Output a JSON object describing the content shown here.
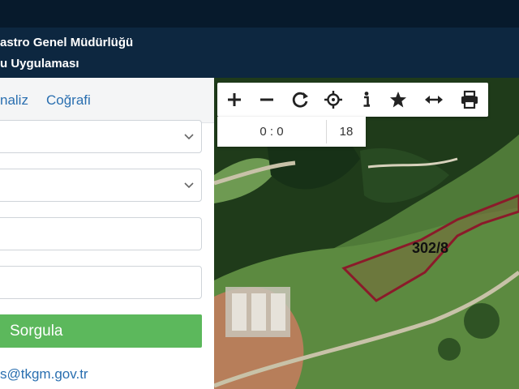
{
  "header": {
    "title_line1": "astro Genel Müdürlüğü",
    "title_line2": "u Uygulaması"
  },
  "panel": {
    "tabs": [
      {
        "label": "naliz"
      },
      {
        "label": "Coğrafi"
      }
    ],
    "fields": [
      {
        "type": "select",
        "value": ""
      },
      {
        "type": "select",
        "value": ""
      },
      {
        "type": "text",
        "value": ""
      },
      {
        "type": "text",
        "value": ""
      }
    ],
    "query_button": "Sorgula",
    "contact_email": "s@tkgm.gov.tr"
  },
  "map": {
    "toolbar": {
      "tools": [
        "zoom-in-icon",
        "zoom-out-icon",
        "refresh-icon",
        "locate-icon",
        "info-icon",
        "favorite-star-icon",
        "measure-icon",
        "print-icon"
      ]
    },
    "coords": "0 : 0",
    "zoom_level": "18",
    "parcel_label": "302/8",
    "parcel_color": "#8b1a2a"
  },
  "colors": {
    "header_bg": "#0d2740",
    "accent_link": "#2a6fb0",
    "button_green": "#5cb85c"
  }
}
